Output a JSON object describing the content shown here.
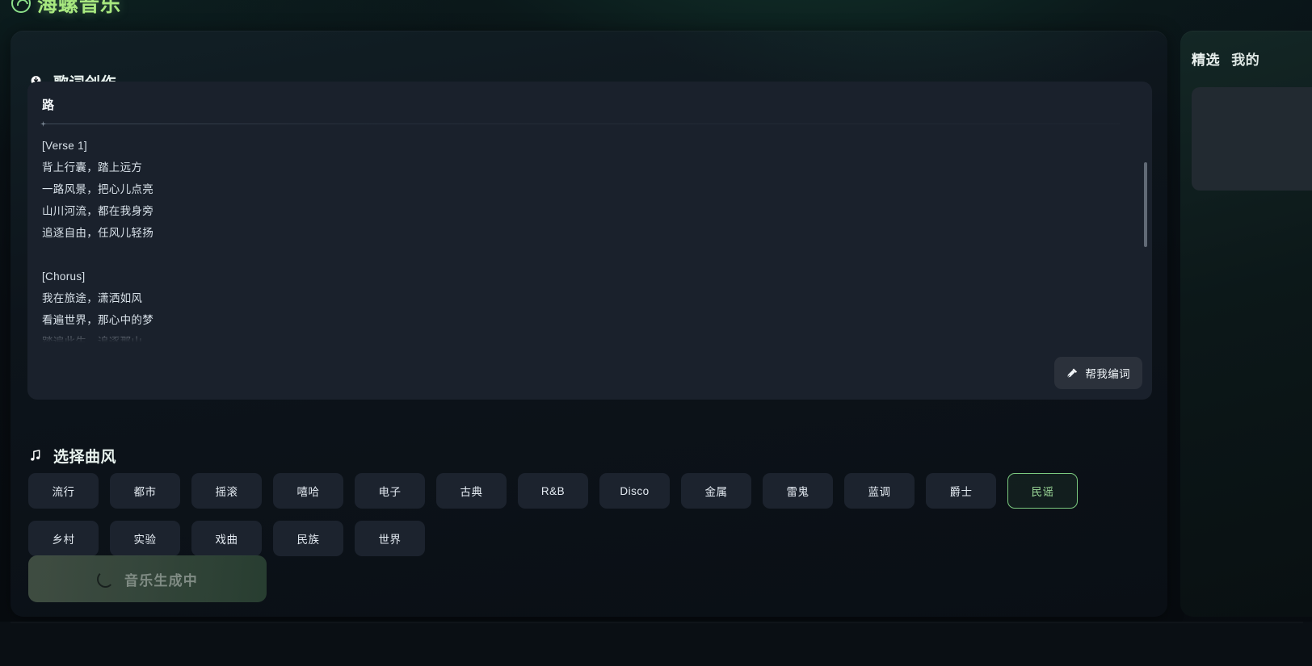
{
  "brand": {
    "title": "海螺音乐",
    "logo_icon": "shell-spiral-icon",
    "accent_color": "#a8e87f"
  },
  "lyrics_section": {
    "icon": "lightbulb-icon",
    "heading": "歌词创作",
    "editor": {
      "song_title": "路",
      "divider_icon": "sparkle-icon",
      "lines": [
        "[Verse 1]",
        "背上行囊，踏上远方",
        "一路风景，把心儿点亮",
        "山川河流，都在我身旁",
        "追逐自由，任风儿轻扬",
        "",
        "[Chorus]",
        "我在旅途，潇洒如风",
        "看遍世界，那心中的梦",
        "踏遍此生，追逐那山"
      ],
      "scrollbar_visible": true
    },
    "assist_button": {
      "label": "帮我编词",
      "icon": "magic-wand-icon"
    }
  },
  "genre_section": {
    "icon": "music-note-icon",
    "heading": "选择曲风",
    "selected": "民谣",
    "selected_border_color": "#7bc97f",
    "options": [
      "流行",
      "都市",
      "摇滚",
      "嘻哈",
      "电子",
      "古典",
      "R&B",
      "Disco",
      "金属",
      "雷鬼",
      "蓝调",
      "爵士",
      "民谣",
      "乡村",
      "实验",
      "戏曲",
      "民族",
      "世界"
    ]
  },
  "generate_button": {
    "label": "音乐生成中",
    "icon": "loading-spinner-icon",
    "state": "loading",
    "disabled": true
  },
  "right_panel": {
    "tabs": [
      {
        "label": "精选",
        "active": true
      },
      {
        "label": "我的",
        "active": false
      }
    ]
  }
}
